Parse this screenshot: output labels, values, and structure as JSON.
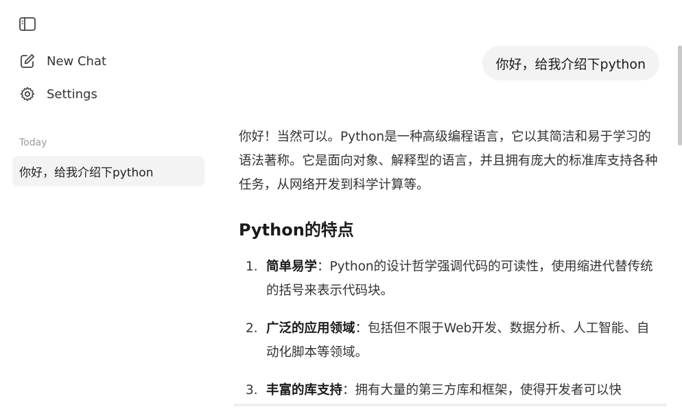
{
  "sidebar": {
    "new_chat_label": "New Chat",
    "settings_label": "Settings",
    "section_today": "Today",
    "history": [
      {
        "label": "你好，给我介绍下python"
      }
    ]
  },
  "conversation": {
    "user_message": "你好，给我介绍下python",
    "assistant": {
      "intro": "你好！当然可以。Python是一种高级编程语言，它以其简洁和易于学习的语法著称。它是面向对象、解释型的语言，并且拥有庞大的标准库支持各种任务，从网络开发到科学计算等。",
      "heading": "Python的特点",
      "items": [
        {
          "num": "1.",
          "title": "简单易学",
          "text": "：Python的设计哲学强调代码的可读性，使用缩进代替传统的括号来表示代码块。"
        },
        {
          "num": "2.",
          "title": "广泛的应用领域",
          "text": "：包括但不限于Web开发、数据分析、人工智能、自动化脚本等领域。"
        },
        {
          "num": "3.",
          "title": "丰富的库支持",
          "text": "：拥有大量的第三方库和框架，使得开发者可以快"
        }
      ]
    }
  }
}
